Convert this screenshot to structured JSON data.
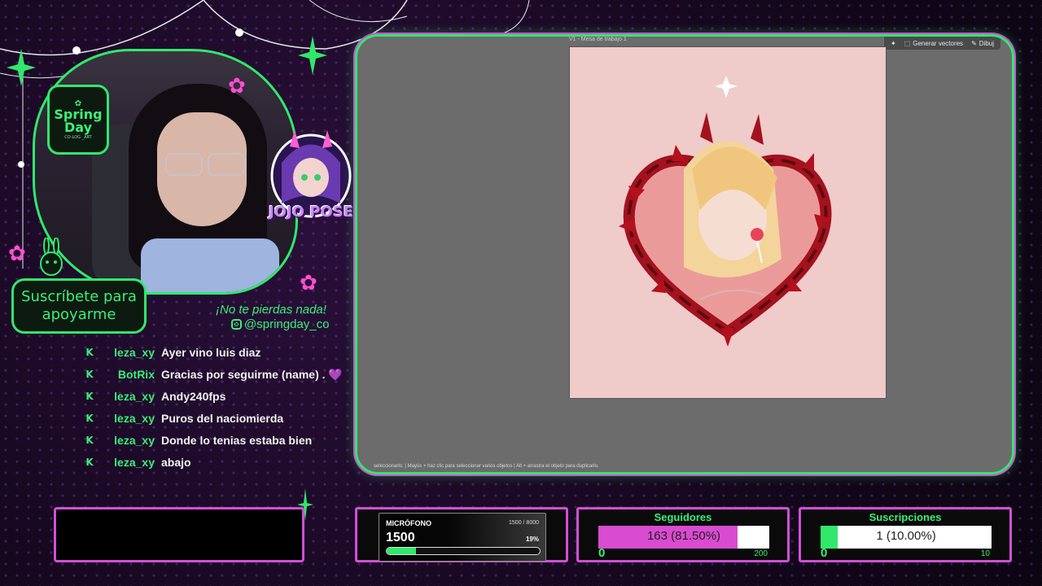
{
  "brand": {
    "line1": "Spring",
    "line2": "Day",
    "tagline": "CO-LOG _ART"
  },
  "subscribe_panel": {
    "text": "Suscríbete para apoyarme"
  },
  "sticker": {
    "label": "JOJO POSE"
  },
  "social": {
    "tagline": "¡No te pierdas nada!",
    "handle": "@springday_co"
  },
  "canvas": {
    "artboard_label": "V1 - Mesa de trabajo 1",
    "toolbar": {
      "generate_vectors": "Generar vectores",
      "draw": "Dibuj"
    },
    "status": "seleccionarlo.  |  Mayús + haz clic para seleccionar varios objetos  |  Alt + arrastra el objeto para duplicarlo."
  },
  "chat": [
    {
      "user": "leza_xy",
      "msg": "Ayer vino luis diaz",
      "icon": "kick-icon"
    },
    {
      "user": "BotRix",
      "msg": "Gracias por seguirme (name) . 💜",
      "icon": "kick-icon"
    },
    {
      "user": "leza_xy",
      "msg": "Andy240fps",
      "icon": "kick-icon"
    },
    {
      "user": "leza_xy",
      "msg": "Puros del naciomierda",
      "icon": "kick-icon"
    },
    {
      "user": "leza_xy",
      "msg": "Donde lo tenias estaba bien",
      "icon": "kick-icon"
    },
    {
      "user": "leza_xy",
      "msg": "abajo",
      "icon": "kick-icon"
    }
  ],
  "mic": {
    "title": "MICRÓFONO",
    "range": "1500 / 8000",
    "value": "1500",
    "percent_label": "19%",
    "percent": 19
  },
  "followers": {
    "title": "Seguidores",
    "text": "163 (81.50%)",
    "min": "0",
    "max": "200",
    "fraction": 0.815,
    "color": "#d94bd0"
  },
  "subs": {
    "title": "Suscripciones",
    "text": "1 (10.00%)",
    "min": "0",
    "max": "10",
    "fraction": 0.1,
    "color": "#31e86b"
  },
  "colors": {
    "accent_green": "#31e86b",
    "accent_pink": "#d24fd6"
  }
}
